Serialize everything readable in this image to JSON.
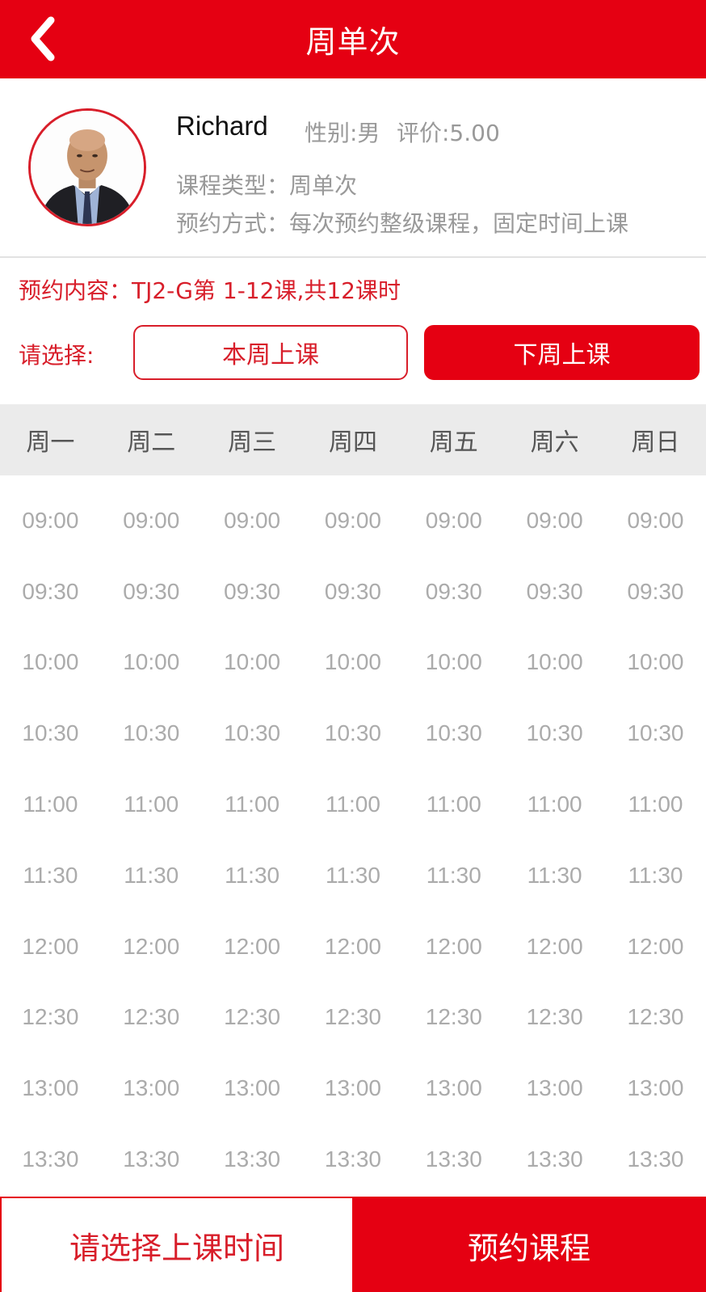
{
  "header": {
    "title": "周单次",
    "back_icon": "chevron-left-icon"
  },
  "teacher": {
    "name": "Richard",
    "gender": "性别:男",
    "rating": "评价:5.00",
    "course_type": "课程类型：周单次",
    "booking_mode": "预约方式：每次预约整级课程，固定时间上课"
  },
  "booking": {
    "content": "预约内容：TJ2-G第 1-12课,共12课时",
    "select_label": "请选择:",
    "this_week_label": "本周上课",
    "next_week_label": "下周上课",
    "selected": "next_week"
  },
  "days": [
    "周一",
    "周二",
    "周三",
    "周四",
    "周五",
    "周六",
    "周日"
  ],
  "times": [
    "09:00",
    "09:30",
    "10:00",
    "10:30",
    "11:00",
    "11:30",
    "12:00",
    "12:30",
    "13:00",
    "13:30"
  ],
  "footer": {
    "choose_time_label": "请选择上课时间",
    "book_label": "预约课程"
  },
  "colors": {
    "accent": "#e50012",
    "muted_text": "#999999",
    "slot_text": "#ababab",
    "day_bar_bg": "#ebebeb"
  }
}
